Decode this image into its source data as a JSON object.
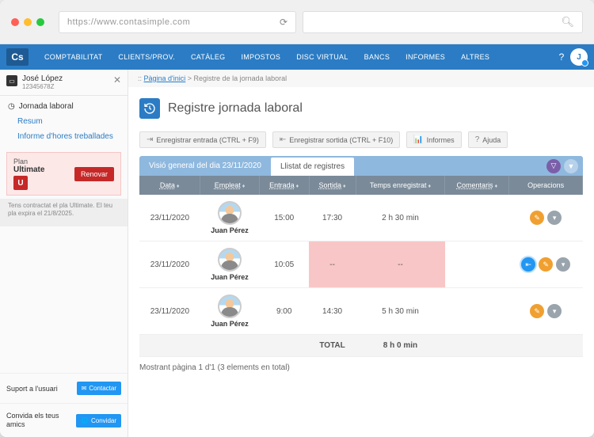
{
  "browser": {
    "url": "https://www.contasimple.com"
  },
  "logo": "Cs",
  "nav": [
    "COMPTABILITAT",
    "CLIENTS/PROV.",
    "CATÀLEG",
    "IMPOSTOS",
    "DISC VIRTUAL",
    "BANCS",
    "INFORMES",
    "ALTRES"
  ],
  "avatar_initial": "J",
  "user": {
    "name": "José López",
    "id": "12345678Z"
  },
  "side": {
    "section": "Jornada laboral",
    "links": [
      "Resum",
      "Informe d'hores treballades"
    ],
    "plan_label": "Plan",
    "plan_name": "Ultimate",
    "plan_badge": "U",
    "renew": "Renovar",
    "plan_note": "Tens contractat el pla Ultimate. El teu pla expira el 21/8/2025.",
    "support_label": "Suport a l'usuari",
    "support_btn": "Contactar",
    "invite_label": "Convida els teus amics",
    "invite_btn": "Convidar"
  },
  "breadcrumb": {
    "home": "Pàgina d'inici",
    "sep": " > ",
    "current": "Registre de la jornada laboral"
  },
  "page_title": "Registre jornada laboral",
  "toolbar": {
    "checkin": "Enregistrar entrada (CTRL + F9)",
    "checkout": "Enregistrar sortida (CTRL + F10)",
    "reports": "Informes",
    "help": "Ajuda"
  },
  "tabs": {
    "overview": "Visió general del dia 23/11/2020",
    "list": "Llistat de registres"
  },
  "headers": {
    "date": "Data",
    "employee": "Empleat",
    "in": "Entrada",
    "out": "Sortida",
    "time": "Temps enregistrat",
    "comments": "Comentaris",
    "ops": "Operacions"
  },
  "rows": [
    {
      "date": "23/11/2020",
      "emp": "Juan Pérez",
      "in": "15:00",
      "out": "17:30",
      "time": "2 h 30 min",
      "in_red": false,
      "out_red": false,
      "ops": [
        "edit",
        "more"
      ]
    },
    {
      "date": "23/11/2020",
      "emp": "Juan Pérez",
      "in": "10:05",
      "out": "--",
      "time": "--",
      "in_red": false,
      "out_red": true,
      "time_red": true,
      "ops": [
        "clock",
        "edit",
        "more"
      ]
    },
    {
      "date": "23/11/2020",
      "emp": "Juan Pérez",
      "in": "9:00",
      "out": "14:30",
      "time": "5 h 30 min",
      "in_red": false,
      "out_red": false,
      "ops": [
        "edit",
        "more"
      ]
    }
  ],
  "total": {
    "label": "TOTAL",
    "value": "8 h 0 min"
  },
  "pager": "Mostrant pàgina 1 d'1 (3 elements en total)"
}
